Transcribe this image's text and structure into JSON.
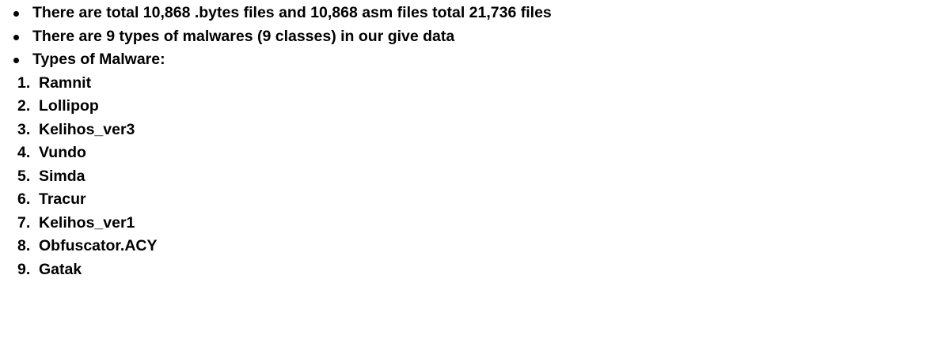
{
  "bullets": [
    "There are total 10,868 .bytes files and 10,868 asm files total 21,736 files",
    "There are 9 types of malwares (9 classes) in our give data",
    "Types of Malware:"
  ],
  "malware_types": [
    {
      "num": "1.",
      "name": "Ramnit"
    },
    {
      "num": "2.",
      "name": "Lollipop"
    },
    {
      "num": "3.",
      "name": "Kelihos_ver3"
    },
    {
      "num": "4.",
      "name": "Vundo"
    },
    {
      "num": "5.",
      "name": "Simda"
    },
    {
      "num": "6.",
      "name": "Tracur"
    },
    {
      "num": "7.",
      "name": "Kelihos_ver1"
    },
    {
      "num": "8.",
      "name": "Obfuscator.ACY"
    },
    {
      "num": "9.",
      "name": "Gatak"
    }
  ]
}
